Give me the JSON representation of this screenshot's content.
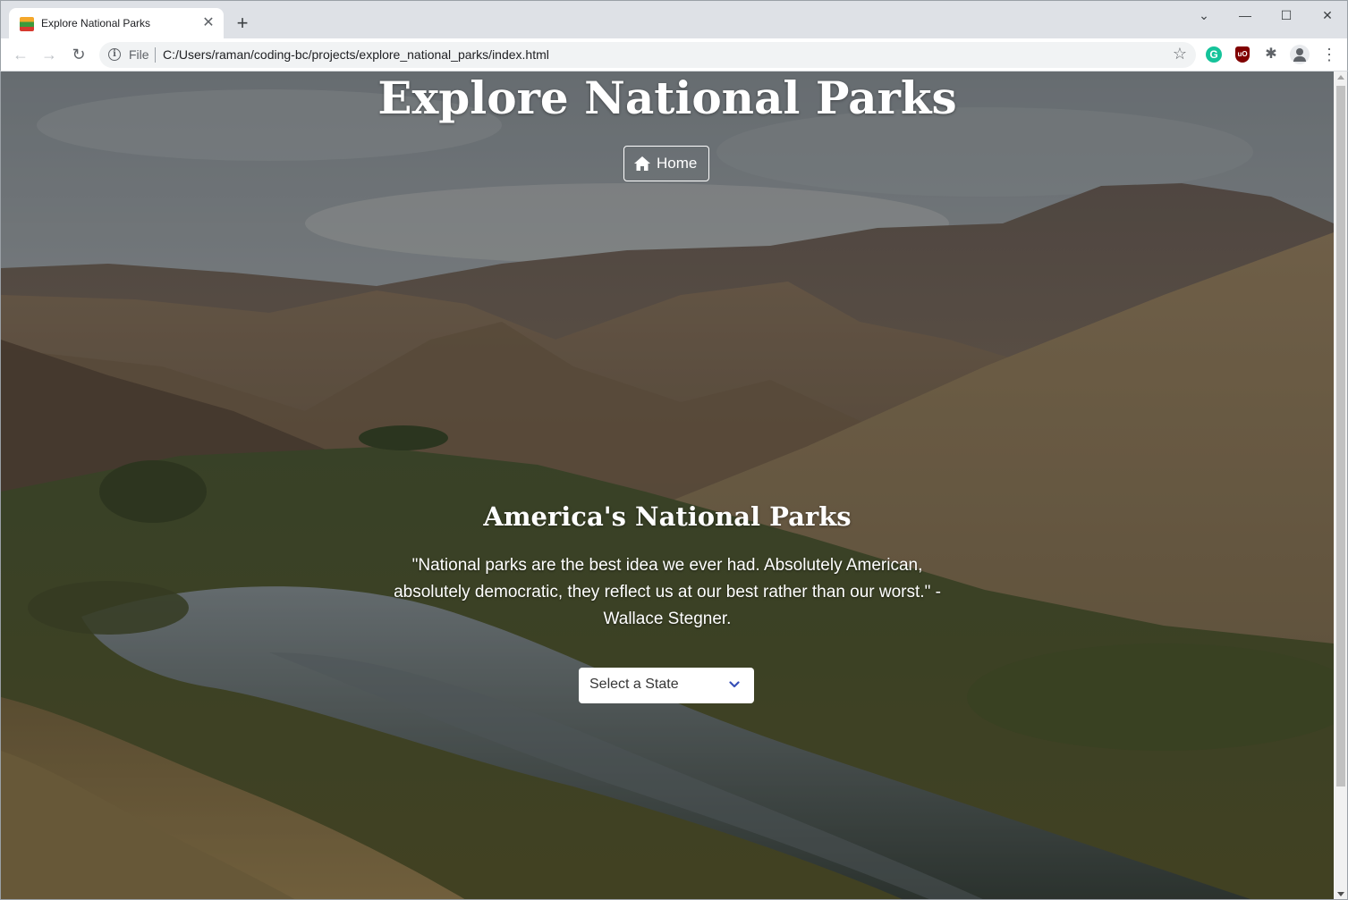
{
  "browser": {
    "tab_title": "Explore National Parks",
    "tab_close": "✕",
    "new_tab": "+",
    "window_controls": {
      "minimize": "—",
      "maximize": "☐",
      "close": "✕",
      "tab_search": "⌄"
    },
    "url_scheme": "File",
    "url": "C:/Users/raman/coding-bc/projects/explore_national_parks/index.html",
    "icons": [
      "back-icon",
      "forward-icon",
      "reload-icon",
      "info-icon",
      "star-icon",
      "grammarly-icon",
      "ublock-icon",
      "extensions-icon",
      "profile-icon",
      "menu-icon"
    ],
    "extension_glyphs": {
      "grammarly": "G",
      "ublock": "uO",
      "puzzle": "✱",
      "menu": "⋮",
      "back": "←",
      "forward": "→",
      "reload": "↻",
      "star": "☆",
      "info": "i"
    }
  },
  "page": {
    "title": "Explore National Parks",
    "home_button_label": "Home",
    "subheading": "America's National Parks",
    "quote": "\"National parks are the best idea we ever had. Absolutely American, absolutely democratic, they reflect us at our best rather than our worst.\" - Wallace Stegner.",
    "state_select_label": "Select a State"
  },
  "colors": {
    "overlay": "rgba(0,0,0,0.28)",
    "text": "#ffffff",
    "select_chevron": "#3850b7",
    "chrome_tab_strip": "#dee1e6"
  }
}
